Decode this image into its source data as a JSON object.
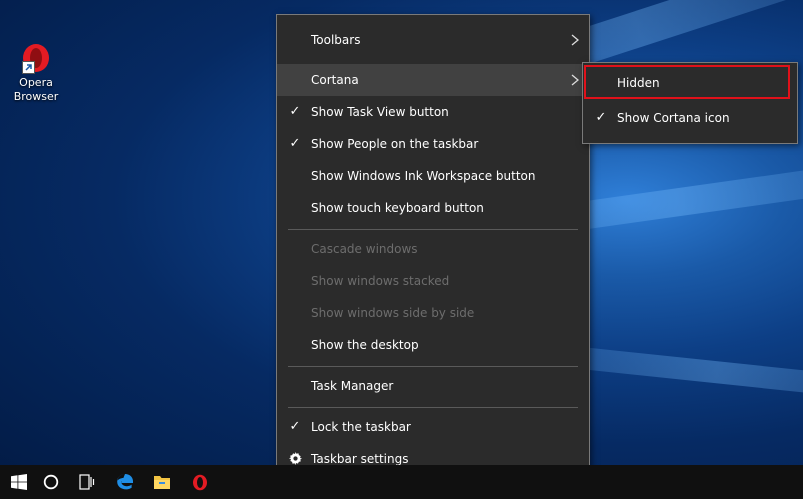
{
  "desktop": {
    "icons": [
      {
        "name": "Opera Browser",
        "line1": "Opera",
        "line2": "Browser"
      }
    ]
  },
  "context_menu": {
    "items": [
      {
        "label": "Toolbars",
        "check": "",
        "submenu": true,
        "disabled": false
      },
      {
        "label": "Cortana",
        "check": "",
        "submenu": true,
        "disabled": false,
        "hover": true
      },
      {
        "label": "Show Task View button",
        "check": "✓",
        "submenu": false,
        "disabled": false
      },
      {
        "label": "Show People on the taskbar",
        "check": "✓",
        "submenu": false,
        "disabled": false
      },
      {
        "label": "Show Windows Ink Workspace button",
        "check": "",
        "submenu": false,
        "disabled": false
      },
      {
        "label": "Show touch keyboard button",
        "check": "",
        "submenu": false,
        "disabled": false
      },
      {
        "label": "Cascade windows",
        "check": "",
        "submenu": false,
        "disabled": true
      },
      {
        "label": "Show windows stacked",
        "check": "",
        "submenu": false,
        "disabled": true
      },
      {
        "label": "Show windows side by side",
        "check": "",
        "submenu": false,
        "disabled": true
      },
      {
        "label": "Show the desktop",
        "check": "",
        "submenu": false,
        "disabled": false
      },
      {
        "label": "Task Manager",
        "check": "",
        "submenu": false,
        "disabled": false
      },
      {
        "label": "Lock the taskbar",
        "check": "✓",
        "submenu": false,
        "disabled": false
      },
      {
        "label": "Taskbar settings",
        "check": "gear-icon",
        "submenu": false,
        "disabled": false
      }
    ]
  },
  "cortana_submenu": {
    "items": [
      {
        "label": "Hidden",
        "check": "",
        "highlighted": true
      },
      {
        "label": "Show Cortana icon",
        "check": "✓",
        "highlighted": false
      }
    ]
  },
  "taskbar": {
    "buttons": [
      "windows-start-icon",
      "cortana-search-icon",
      "task-view-icon",
      "edge-browser-icon",
      "file-explorer-icon",
      "opera-browser-icon"
    ]
  },
  "colors": {
    "menu_bg": "#2b2b2b",
    "menu_hover": "#414141",
    "highlight_box": "#e0111a",
    "taskbar_bg": "#101010"
  }
}
